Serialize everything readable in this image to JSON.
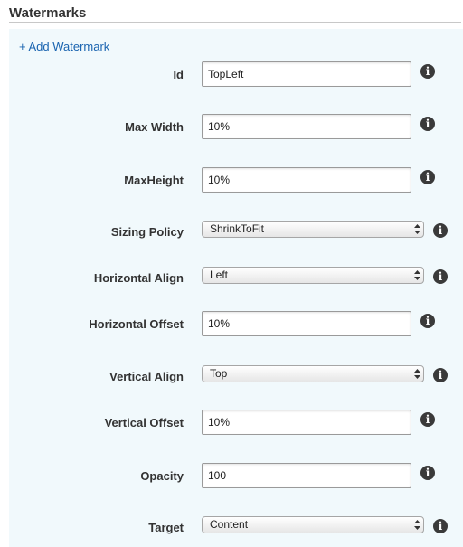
{
  "section": {
    "title": "Watermarks"
  },
  "add_link": "+ Add Watermark",
  "info_icon": "info-icon",
  "fields": {
    "id": {
      "label": "Id",
      "value": "TopLeft"
    },
    "max_width": {
      "label": "Max Width",
      "value": "10%"
    },
    "max_height": {
      "label": "MaxHeight",
      "value": "10%"
    },
    "sizing_policy": {
      "label": "Sizing Policy",
      "value": "ShrinkToFit"
    },
    "horizontal_align": {
      "label": "Horizontal Align",
      "value": "Left"
    },
    "horizontal_offset": {
      "label": "Horizontal Offset",
      "value": "10%"
    },
    "vertical_align": {
      "label": "Vertical Align",
      "value": "Top"
    },
    "vertical_offset": {
      "label": "Vertical Offset",
      "value": "10%"
    },
    "opacity": {
      "label": "Opacity",
      "value": "100"
    },
    "target": {
      "label": "Target",
      "value": "Content"
    }
  },
  "colors": {
    "panel_background": "#f1f9fc",
    "link": "#1a64b0",
    "label_text": "#333333"
  }
}
